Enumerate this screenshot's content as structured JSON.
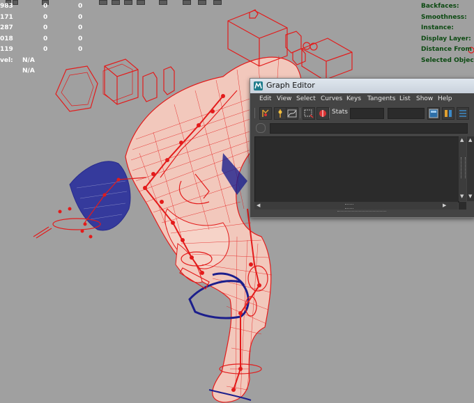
{
  "hud_left": {
    "rows": [
      {
        "label": "983",
        "v1": "0",
        "v2": "0"
      },
      {
        "label": "171",
        "v1": "0",
        "v2": "0"
      },
      {
        "label": "287",
        "v1": "0",
        "v2": "0"
      },
      {
        "label": "018",
        "v1": "0",
        "v2": "0"
      },
      {
        "label": "119",
        "v1": "0",
        "v2": "0"
      },
      {
        "label": "vel:",
        "v1": "N/A",
        "v2": ""
      },
      {
        "label": "",
        "v1": "N/A",
        "v2": ""
      }
    ]
  },
  "hud_right": {
    "labels": [
      "Backfaces:",
      "Smoothness:",
      "Instance:",
      "Display Layer:",
      "Distance From Ca",
      "Selected Objects"
    ]
  },
  "graph_editor": {
    "title": "Graph Editor",
    "menu": [
      "Edit",
      "View",
      "Select",
      "Curves",
      "Keys",
      "Tangents",
      "List",
      "Show",
      "Help"
    ],
    "stats_label": "Stats",
    "stats_value_1": "",
    "stats_value_2": "",
    "filter_value": ""
  },
  "colors": {
    "viewport_bg": "#a0a0a0",
    "rig_red": "#e31b1b",
    "mesh_blue": "#1c1f8c",
    "skin_fill": "#f2c8bc",
    "hud_green": "#0c4a12",
    "panel_dark": "#444444"
  },
  "icons": [
    "maya-logo-icon",
    "graph-tool-icon",
    "key-tool-icon",
    "curve-icon",
    "frame-select-icon",
    "buffer-icon",
    "filter-icon"
  ]
}
